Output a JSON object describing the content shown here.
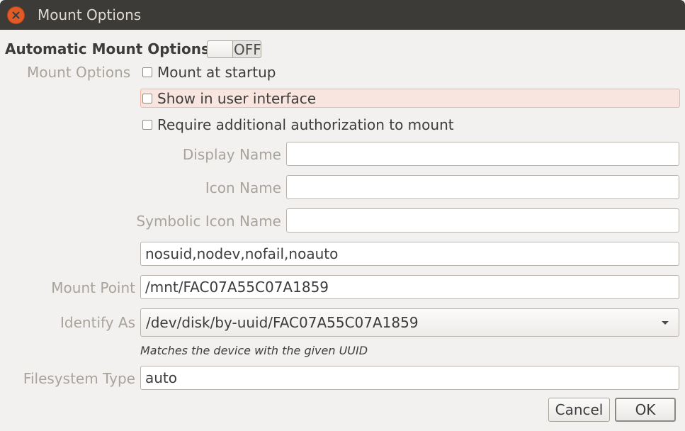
{
  "window": {
    "title": "Mount Options"
  },
  "automatic": {
    "heading": "Automatic Mount Options",
    "switch_state": "OFF"
  },
  "mount_options": {
    "label": "Mount Options",
    "checkboxes": [
      {
        "label": "Mount at startup",
        "checked": false
      },
      {
        "label": "Show in user interface",
        "checked": false
      },
      {
        "label": "Require additional authorization to mount",
        "checked": false
      }
    ]
  },
  "fields": {
    "display_name": {
      "label": "Display Name",
      "value": ""
    },
    "icon_name": {
      "label": "Icon Name",
      "value": ""
    },
    "symbolic_icon_name": {
      "label": "Symbolic Icon Name",
      "value": ""
    },
    "options_string": {
      "value": "nosuid,nodev,nofail,noauto"
    },
    "mount_point": {
      "label": "Mount Point",
      "value": "/mnt/FAC07A55C07A1859"
    },
    "identify_as": {
      "label": "Identify As",
      "value": "/dev/disk/by-uuid/FAC07A55C07A1859",
      "hint": "Matches the device with the given UUID"
    },
    "filesystem_type": {
      "label": "Filesystem Type",
      "value": "auto"
    }
  },
  "buttons": {
    "cancel": "Cancel",
    "ok": "OK"
  },
  "colors": {
    "titlebar": "#3c3b37",
    "close": "#e25a28",
    "highlight": "#f9e5df",
    "window_bg": "#f2f1f0"
  }
}
